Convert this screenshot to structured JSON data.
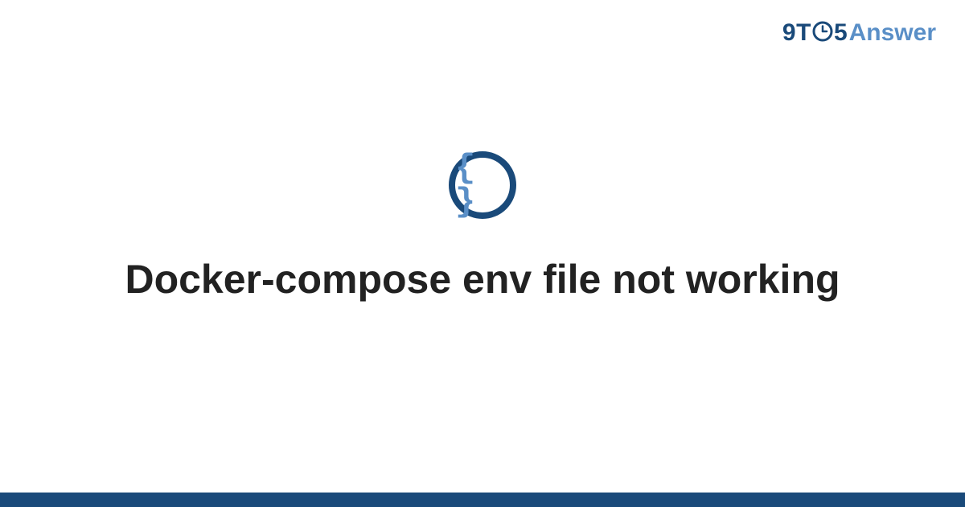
{
  "brand": {
    "part1": "9T",
    "part2": "5",
    "part3": "Answer"
  },
  "icon": {
    "braces": "{ }"
  },
  "title": "Docker-compose env file not working",
  "colors": {
    "brand_dark": "#1a4a7a",
    "brand_light": "#5a8fc7",
    "text": "#222222",
    "background": "#ffffff"
  }
}
